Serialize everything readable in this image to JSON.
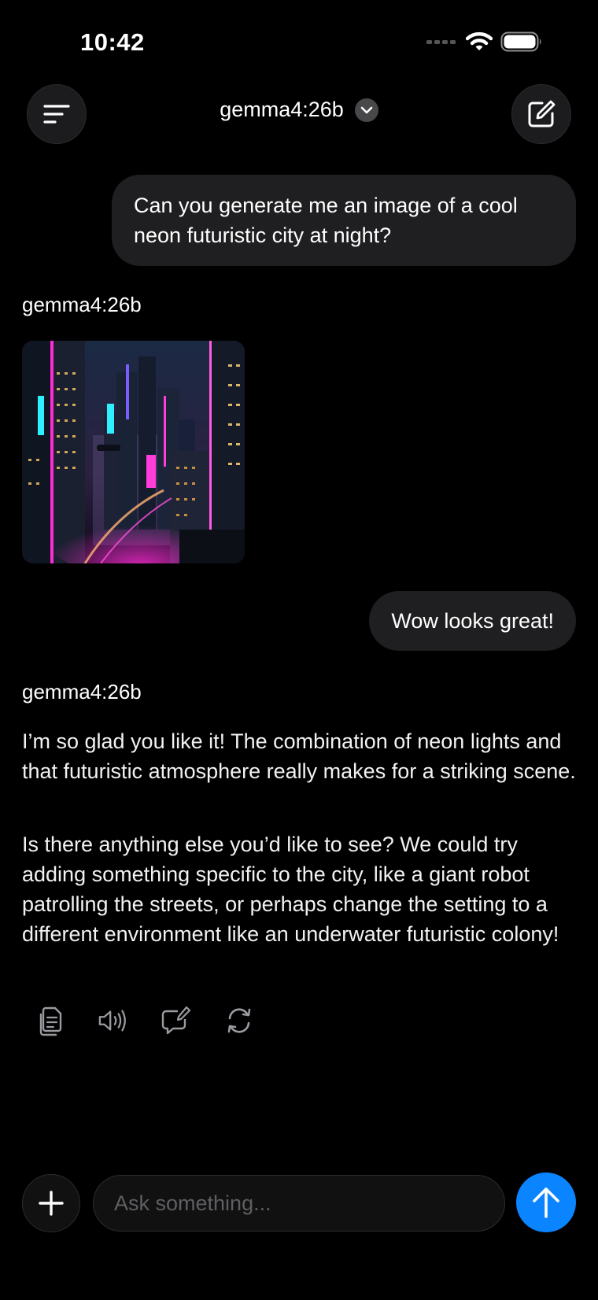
{
  "status_bar": {
    "time": "10:42"
  },
  "header": {
    "model_name": "gemma4:26b",
    "menu_icon": "menu-icon",
    "compose_icon": "compose-icon"
  },
  "messages": [
    {
      "role": "user",
      "text": "Can you generate me an image of a cool neon futuristic city at night?"
    },
    {
      "role": "assistant",
      "label": "gemma4:26b",
      "image": "neon futuristic city"
    },
    {
      "role": "user",
      "text": "Wow looks great!"
    },
    {
      "role": "assistant",
      "label": "gemma4:26b",
      "paragraphs": [
        "I’m so glad you like it! The combination of neon lights and that futuristic atmosphere really makes for a striking scene.",
        "Is there anything else you’d like to see? We could try adding something specific to the city, like a giant robot patrolling the streets, or perhaps change the setting to a different environment like an underwater futuristic colony!"
      ]
    }
  ],
  "actions": [
    "copy-icon",
    "speaker-icon",
    "edit-message-icon",
    "regenerate-icon"
  ],
  "composer": {
    "placeholder": "Ask something...",
    "value": ""
  },
  "colors": {
    "background": "#000000",
    "bubble": "#1f1f21",
    "accent": "#0a84ff"
  }
}
